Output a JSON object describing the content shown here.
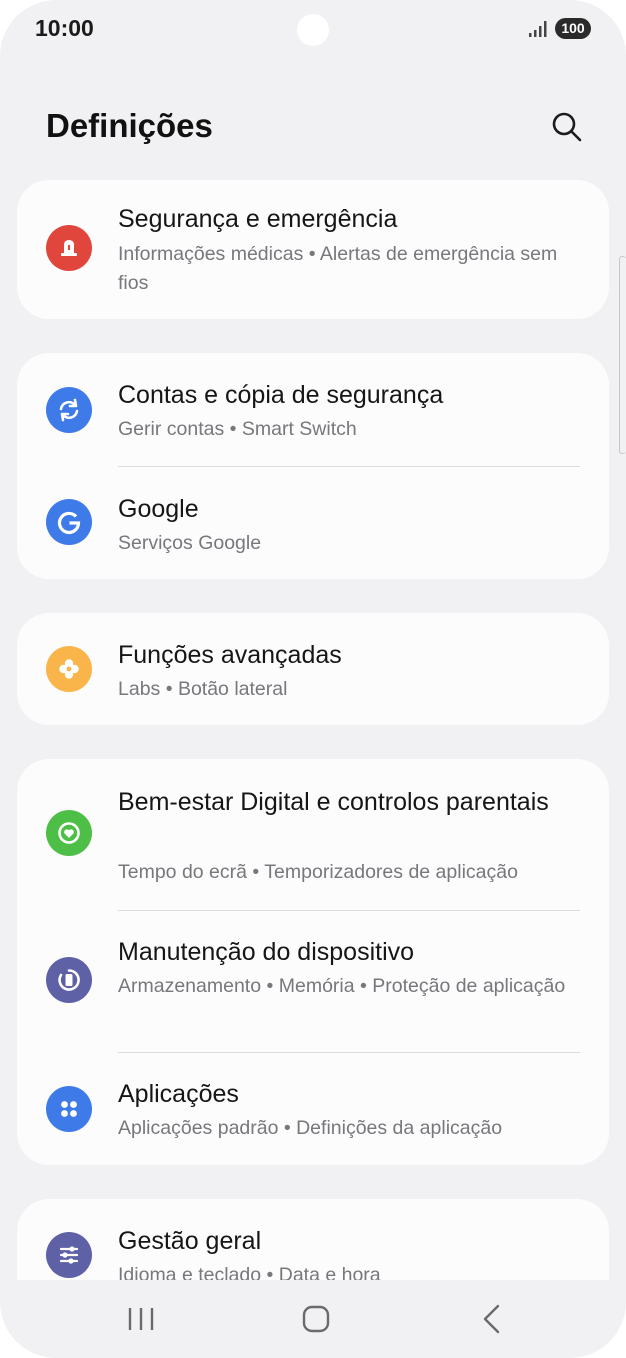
{
  "status": {
    "time": "10:00",
    "battery": "100"
  },
  "header": {
    "title": "Definições"
  },
  "items": [
    {
      "title": "Segurança e emergência",
      "subtitle": "Informações médicas  •  Alertas de emergência sem fios",
      "icon": "siren-icon",
      "color": "#e0463c"
    },
    {
      "title": "Contas e cópia de segurança",
      "subtitle": "Gerir contas  •  Smart Switch",
      "icon": "sync-icon",
      "color": "#3e7be8"
    },
    {
      "title": "Google",
      "subtitle": "Serviços Google",
      "icon": "google-icon",
      "color": "#3e7be8"
    },
    {
      "title": "Funções avançadas",
      "subtitle": "Labs  •  Botão lateral",
      "icon": "advanced-features-icon",
      "color": "#f9b44a"
    },
    {
      "title": "Bem-estar Digital e controlos parentais",
      "subtitle": "Tempo do ecrã  •  Temporizadores de aplicação",
      "icon": "wellbeing-icon",
      "color": "#4dbe46"
    },
    {
      "title": "Manutenção do dispositivo",
      "subtitle": "Armazenamento  •  Memória  •  Proteção de aplicação",
      "icon": "device-care-icon",
      "color": "#5e61a6"
    },
    {
      "title": "Aplicações",
      "subtitle": "Aplicações padrão  •  Definições da aplicação",
      "icon": "apps-icon",
      "color": "#3e7be8"
    },
    {
      "title": "Gestão geral",
      "subtitle": "Idioma e teclado  •  Data e hora",
      "icon": "sliders-icon",
      "color": "#5e61a6"
    }
  ]
}
